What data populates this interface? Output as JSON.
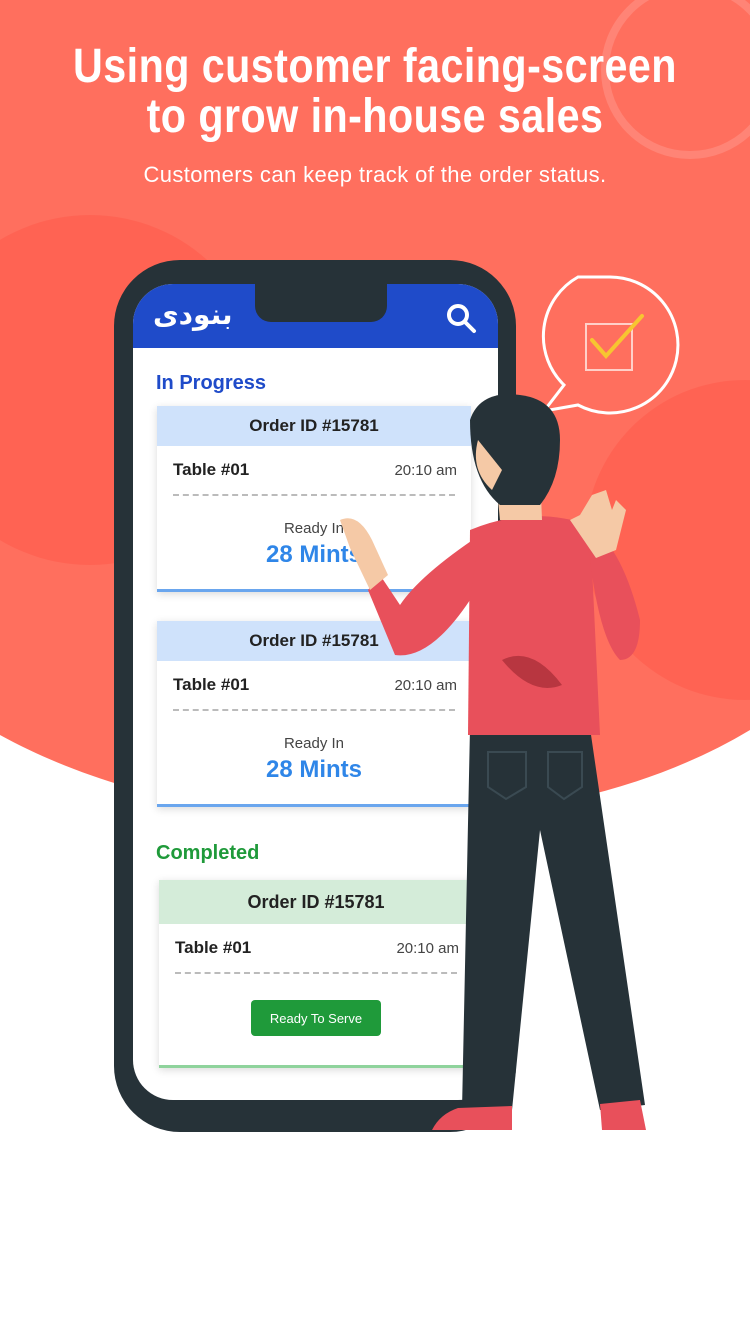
{
  "header": {
    "headline": "Using customer facing-screen to grow in-house sales",
    "subtitle": "Customers can keep track of the order status."
  },
  "app": {
    "brand": "بنودی",
    "search_icon": "search-icon",
    "sections": {
      "in_progress": "In Progress",
      "completed": "Completed"
    },
    "orders_in_progress": [
      {
        "order_id": "Order ID #15781",
        "table": "Table #01",
        "time": "20:10 am",
        "ready_label": "Ready In",
        "ready_value": "28 Mints"
      },
      {
        "order_id": "Order ID #15781",
        "table": "Table #01",
        "time": "20:10 am",
        "ready_label": "Ready In",
        "ready_value": "28 Mints"
      }
    ],
    "orders_completed": [
      {
        "order_id": "Order ID #15781",
        "table": "Table #01",
        "time": "20:10 am",
        "action": "Ready To Serve"
      }
    ]
  },
  "colors": {
    "background_coral": "#ff6f5e",
    "app_blue": "#1f4bc9",
    "completed_green": "#1f9a3a",
    "phone_frame": "#263238"
  }
}
